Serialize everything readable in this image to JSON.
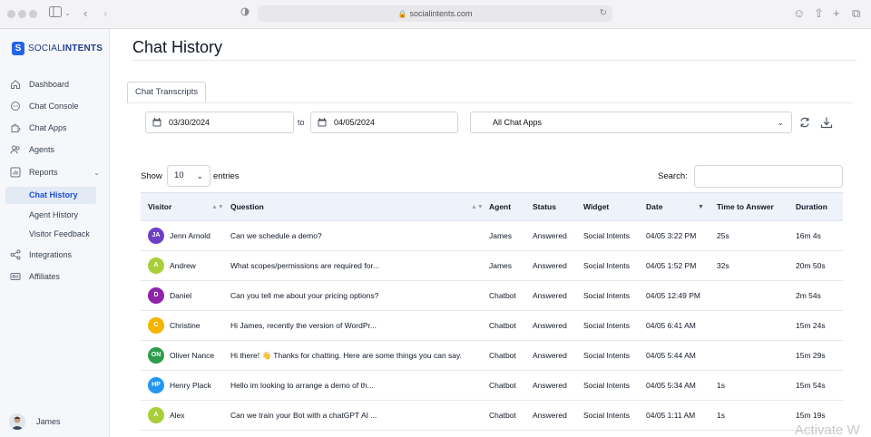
{
  "browser": {
    "url": "socialintents.com"
  },
  "sidebar": {
    "logo_light": "SOCIAL",
    "logo_bold": "INTENTS",
    "logo_mark": "S",
    "items": [
      {
        "label": "Dashboard",
        "icon": "home-icon"
      },
      {
        "label": "Chat Console",
        "icon": "chat-icon"
      },
      {
        "label": "Chat Apps",
        "icon": "puzzle-icon"
      },
      {
        "label": "Agents",
        "icon": "users-icon"
      },
      {
        "label": "Reports",
        "icon": "chart-icon"
      }
    ],
    "sub_items": [
      {
        "label": "Chat History",
        "active": true
      },
      {
        "label": "Agent History",
        "active": false
      },
      {
        "label": "Visitor Feedback",
        "active": false
      }
    ],
    "items_bottom": [
      {
        "label": "Integrations",
        "icon": "share-icon"
      },
      {
        "label": "Affiliates",
        "icon": "affiliates-icon"
      }
    ],
    "user": "James"
  },
  "main": {
    "title": "Chat History",
    "tab": "Chat Transcripts",
    "date_from": "03/30/2024",
    "to_label": "to",
    "date_to": "04/05/2024",
    "app_select": "All Chat Apps",
    "show_label": "Show",
    "entries_value": "10",
    "entries_label": "entries",
    "search_label": "Search:"
  },
  "table": {
    "columns": [
      "Visitor",
      "Question",
      "Agent",
      "Status",
      "Widget",
      "Date",
      "Time to Answer",
      "Duration"
    ],
    "rows": [
      {
        "initials": "JA",
        "color": "#6d3fc6",
        "visitor": "Jenn Arnold",
        "question": "Can we schedule a demo?",
        "agent": "James",
        "status": "Answered",
        "widget": "Social Intents",
        "date": "04/05 3:22 PM",
        "tta": "25s",
        "duration": "16m 4s"
      },
      {
        "initials": "A",
        "color": "#a8cf3a",
        "visitor": "Andrew",
        "question": "What scopes/permissions are required for...",
        "agent": "James",
        "status": "Answered",
        "widget": "Social Intents",
        "date": "04/05 1:52 PM",
        "tta": "32s",
        "duration": "20m 50s"
      },
      {
        "initials": "D",
        "color": "#8e24aa",
        "visitor": "Daniel",
        "question": "Can you tell me about your pricing options?",
        "agent": "Chatbot",
        "status": "Answered",
        "widget": "Social Intents",
        "date": "04/05 12:49 PM",
        "tta": "",
        "duration": "2m 54s"
      },
      {
        "initials": "C",
        "color": "#f5b400",
        "visitor": "Christine",
        "question": "Hi James, recently the version of WordPr...",
        "agent": "Chatbot",
        "status": "Answered",
        "widget": "Social Intents",
        "date": "04/05 6:41 AM",
        "tta": "",
        "duration": "15m 24s"
      },
      {
        "initials": "ON",
        "color": "#2e9d4a",
        "visitor": "Oliver Nance",
        "question": "Hi there! 👋 Thanks for chatting. Here are some things you can say.",
        "agent": "Chatbot",
        "status": "Answered",
        "widget": "Social Intents",
        "date": "04/05 5:44 AM",
        "tta": "",
        "duration": "15m 29s"
      },
      {
        "initials": "HP",
        "color": "#2196f3",
        "visitor": "Henry Plack",
        "question": "Hello im looking to arrange a demo of th...",
        "agent": "Chatbot",
        "status": "Answered",
        "widget": "Social Intents",
        "date": "04/05 5:34 AM",
        "tta": "1s",
        "duration": "15m 54s"
      },
      {
        "initials": "A",
        "color": "#a8cf3a",
        "visitor": "Alex",
        "question": "Can we train your Bot with a chatGPT AI ...",
        "agent": "Chatbot",
        "status": "Answered",
        "widget": "Social Intents",
        "date": "04/05 1:11 AM",
        "tta": "1s",
        "duration": "15m 19s"
      }
    ]
  },
  "watermark": "Activate W"
}
